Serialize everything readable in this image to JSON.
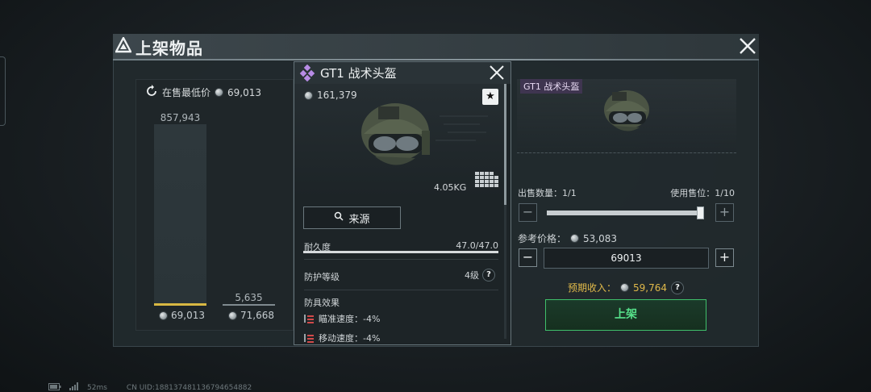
{
  "dialog": {
    "title": "上架物品"
  },
  "market": {
    "lowest_label": "在售最低价",
    "lowest_value": "69,013",
    "bars": [
      {
        "top_label": "857,943",
        "price": "69,013",
        "selected": true
      },
      {
        "top_label": "5,635",
        "price": "71,668",
        "selected": false
      }
    ]
  },
  "item": {
    "name": "GT1 战术头盔",
    "price": "161,379",
    "weight": "4.05KG",
    "source_label": "来源",
    "durability_label": "耐久度",
    "durability_value": "47.0/47.0",
    "durability_fraction": 1.0,
    "protection_label": "防护等级",
    "protection_value": "4级",
    "effects_title": "防具效果",
    "effects": [
      {
        "label": "瞄准速度：-4%"
      },
      {
        "label": "移动速度：-4%"
      }
    ]
  },
  "sell": {
    "tag": "GT1 战术头盔",
    "quantity_label": "出售数量：1/1",
    "slots_label": "使用售位：1/10",
    "quantity_fraction": 1.0,
    "ref_price_label": "参考价格：",
    "ref_price_value": "53,083",
    "price_input": "69013",
    "expected_label": "预期收入：",
    "expected_value": "59,764",
    "confirm_label": "上架"
  },
  "status_bar": {
    "latency": "52ms",
    "uid": "CN UID:1881374811367946548​82"
  },
  "colors": {
    "accent_gold": "#d8b843",
    "confirm_green": "#56e08a",
    "tag_purple": "#3f3550"
  }
}
